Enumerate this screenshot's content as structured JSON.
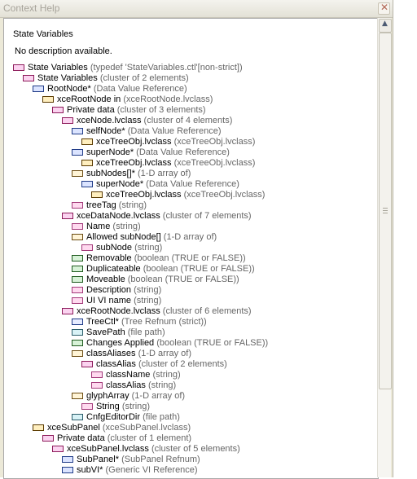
{
  "window": {
    "title": "Context Help",
    "close_glyph": "✕"
  },
  "help": {
    "heading": "State Variables",
    "description": "No description available."
  },
  "tree": [
    {
      "indent": 0,
      "icon": "cluster",
      "name": "State Variables",
      "type": "(typedef 'StateVariables.ctl'[non-strict])"
    },
    {
      "indent": 1,
      "icon": "cluster",
      "name": "State Variables",
      "type": "(cluster of 2 elements)"
    },
    {
      "indent": 2,
      "icon": "refnum",
      "name": "RootNode*",
      "type": "(Data Value Reference)"
    },
    {
      "indent": 3,
      "icon": "obj",
      "name": "xceRootNode in",
      "type": "(xceRootNode.lvclass)"
    },
    {
      "indent": 4,
      "icon": "cluster",
      "name": "Private data",
      "type": "(cluster of 3 elements)"
    },
    {
      "indent": 5,
      "icon": "cluster",
      "name": "xceNode.lvclass",
      "type": "(cluster of 4 elements)"
    },
    {
      "indent": 6,
      "icon": "refnum",
      "name": "selfNode*",
      "type": "(Data Value Reference)"
    },
    {
      "indent": 7,
      "icon": "obj",
      "name": "xceTreeObj.lvclass",
      "type": "(xceTreeObj.lvclass)"
    },
    {
      "indent": 6,
      "icon": "refnum",
      "name": "superNode*",
      "type": "(Data Value Reference)"
    },
    {
      "indent": 7,
      "icon": "obj",
      "name": "xceTreeObj.lvclass",
      "type": "(xceTreeObj.lvclass)"
    },
    {
      "indent": 6,
      "icon": "array",
      "name": "subNodes[]*",
      "type": "(1-D array of)"
    },
    {
      "indent": 7,
      "icon": "refnum",
      "name": "superNode*",
      "type": "(Data Value Reference)"
    },
    {
      "indent": 8,
      "icon": "obj",
      "name": "xceTreeObj.lvclass",
      "type": "(xceTreeObj.lvclass)"
    },
    {
      "indent": 6,
      "icon": "string",
      "name": "treeTag",
      "type": "(string)"
    },
    {
      "indent": 5,
      "icon": "cluster",
      "name": "xceDataNode.lvclass",
      "type": "(cluster of 7 elements)"
    },
    {
      "indent": 6,
      "icon": "string",
      "name": "Name",
      "type": "(string)"
    },
    {
      "indent": 6,
      "icon": "array",
      "name": "Allowed subNode[]",
      "type": "(1-D array of)"
    },
    {
      "indent": 7,
      "icon": "string",
      "name": "subNode",
      "type": "(string)"
    },
    {
      "indent": 6,
      "icon": "bool",
      "name": "Removable",
      "type": "(boolean (TRUE or FALSE))"
    },
    {
      "indent": 6,
      "icon": "bool",
      "name": "Duplicateable",
      "type": "(boolean (TRUE or FALSE))"
    },
    {
      "indent": 6,
      "icon": "bool",
      "name": "Moveable",
      "type": "(boolean (TRUE or FALSE))"
    },
    {
      "indent": 6,
      "icon": "string",
      "name": "Description",
      "type": "(string)"
    },
    {
      "indent": 6,
      "icon": "string",
      "name": "UI VI name",
      "type": "(string)"
    },
    {
      "indent": 5,
      "icon": "cluster",
      "name": "xceRootNode.lvclass",
      "type": "(cluster of 6 elements)"
    },
    {
      "indent": 6,
      "icon": "treeref",
      "name": "TreeCtl*",
      "type": "(Tree Refnum  (strict))"
    },
    {
      "indent": 6,
      "icon": "path",
      "name": "SavePath",
      "type": "(file path)"
    },
    {
      "indent": 6,
      "icon": "bool",
      "name": "Changes Applied",
      "type": "(boolean (TRUE or FALSE))"
    },
    {
      "indent": 6,
      "icon": "array",
      "name": "classAliases",
      "type": "(1-D array of)"
    },
    {
      "indent": 7,
      "icon": "cluster",
      "name": "classAlias",
      "type": "(cluster of 2 elements)"
    },
    {
      "indent": 8,
      "icon": "string",
      "name": "className",
      "type": "(string)"
    },
    {
      "indent": 8,
      "icon": "string",
      "name": "classAlias",
      "type": "(string)"
    },
    {
      "indent": 6,
      "icon": "array",
      "name": "glyphArray",
      "type": "(1-D array of)"
    },
    {
      "indent": 7,
      "icon": "string",
      "name": "String",
      "type": "(string)"
    },
    {
      "indent": 6,
      "icon": "path",
      "name": "CnfgEditorDir",
      "type": "(file path)"
    },
    {
      "indent": 2,
      "icon": "obj",
      "name": "xceSubPanel",
      "type": "(xceSubPanel.lvclass)"
    },
    {
      "indent": 3,
      "icon": "cluster",
      "name": "Private data",
      "type": "(cluster of 1 element)"
    },
    {
      "indent": 4,
      "icon": "cluster",
      "name": "xceSubPanel.lvclass",
      "type": "(cluster of 5 elements)"
    },
    {
      "indent": 5,
      "icon": "refnum",
      "name": "SubPanel*",
      "type": "(SubPanel Refnum)"
    },
    {
      "indent": 5,
      "icon": "refnum",
      "name": "subVI*",
      "type": "(Generic VI Reference)"
    }
  ],
  "scrollbar": {
    "up_glyph": "▲",
    "down_glyph": "▼"
  }
}
